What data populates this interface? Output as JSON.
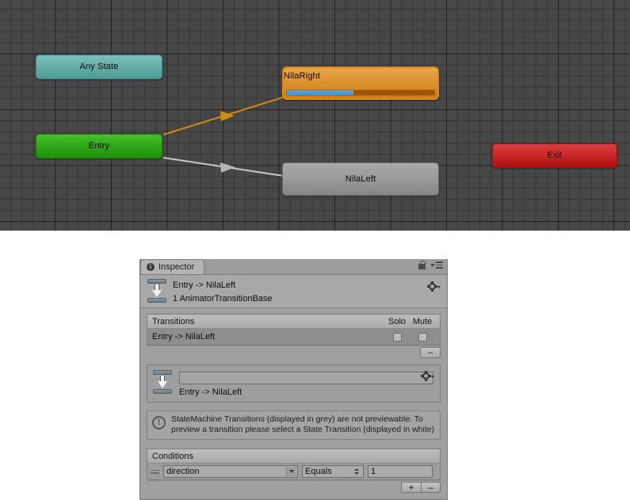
{
  "graph": {
    "nodes": [
      {
        "id": "any-state",
        "label": "Any State",
        "color": "#63aca6"
      },
      {
        "id": "entry",
        "label": "Entry",
        "color": "#2ea516"
      },
      {
        "id": "exit",
        "label": "Exit",
        "color": "#c52626"
      },
      {
        "id": "nilaright",
        "label": "NilaRight",
        "color": "#dd902d",
        "progress_percent": 45,
        "progress_color": "#3d92d0"
      },
      {
        "id": "nilaleft",
        "label": "NilaLeft",
        "color": "#9a9a9a"
      }
    ],
    "transitions": [
      {
        "from": "entry",
        "to": "nilaright",
        "color": "#d08c0a"
      },
      {
        "from": "entry",
        "to": "nilaleft",
        "color": "#c8c8c8"
      }
    ]
  },
  "inspector": {
    "tab_label": "Inspector",
    "tab_icon": "info-icon",
    "lock_icon": "lock-icon",
    "menu_icon": "hamburger-menu-icon",
    "gear_icon": "gear-icon",
    "header": {
      "title": "Entry -> NilaLeft",
      "subtitle": "1 AnimatorTransitionBase",
      "icon": "transition-icon"
    },
    "transitions_section": {
      "title": "Transitions",
      "column_solo": "Solo",
      "column_mute": "Mute",
      "rows": [
        {
          "label": "Entry -> NilaLeft",
          "solo": false,
          "mute": false
        }
      ],
      "remove_button": "–"
    },
    "transition_detail": {
      "icon": "transition-icon",
      "name_value": "",
      "name_placeholder": "",
      "subtitle": "Entry -> NilaLeft",
      "gear_icon": "gear-icon"
    },
    "info_box": {
      "icon": "warning-icon",
      "text": "StateMachine Transitions (displayed in grey) are not previewable. To preview a transition please select a State Transition (displayed in white)"
    },
    "conditions_section": {
      "title": "Conditions",
      "rows": [
        {
          "parameter": "direction",
          "comparison": "Equals",
          "value": "1"
        }
      ],
      "add_button": "+",
      "remove_button": "–"
    }
  }
}
